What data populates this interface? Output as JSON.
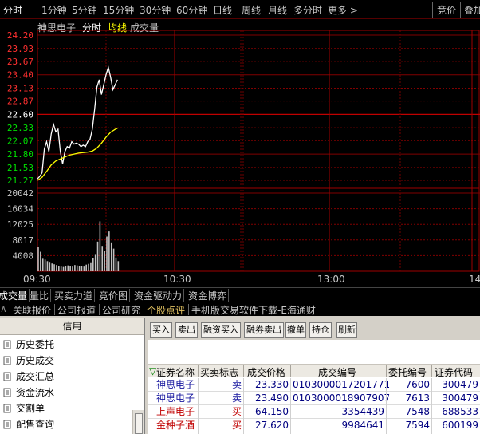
{
  "toolbar": {
    "periods": [
      "分时",
      "1分钟",
      "5分钟",
      "15分钟",
      "30分钟",
      "60分钟",
      "日线",
      "周线",
      "月线",
      "多分时",
      "更多 >"
    ],
    "right_items": [
      "竞价",
      "叠加"
    ]
  },
  "stock": {
    "name": "神思电子",
    "mode": "分时",
    "avg_label": "均线",
    "volume_label": "成交量"
  },
  "chart_data": {
    "type": "line",
    "price_axis": [
      "24.20",
      "23.93",
      "23.67",
      "23.40",
      "23.13",
      "22.87",
      "22.60",
      "22.33",
      "22.07",
      "21.80",
      "21.53",
      "21.27"
    ],
    "reference_price": 22.6,
    "price_range": [
      21.0,
      24.2
    ],
    "volume_axis": [
      "20042",
      "16034",
      "12025",
      "8017",
      "4008"
    ],
    "volume_range": [
      0,
      22000
    ],
    "time_axis": [
      "09:30",
      "10:30",
      "13:00",
      "14"
    ],
    "session_minutes": 240,
    "series": [
      {
        "name": "分时",
        "color": "#ffffff",
        "x": [
          0,
          1,
          2,
          3,
          4,
          5,
          6,
          7,
          8,
          9,
          10,
          11,
          12,
          13,
          14,
          15,
          16,
          17,
          18,
          19,
          20,
          21,
          22,
          23,
          24,
          25,
          26,
          27,
          28,
          29,
          30,
          31,
          32,
          33,
          34,
          35
        ],
        "values": [
          21.3,
          21.35,
          21.42,
          21.9,
          22.05,
          21.85,
          22.2,
          22.4,
          22.25,
          22.3,
          21.85,
          21.6,
          21.85,
          21.95,
          21.92,
          22.05,
          22.0,
          22.02,
          22.0,
          21.95,
          21.98,
          21.95,
          22.05,
          22.1,
          22.3,
          22.7,
          23.15,
          23.3,
          23.0,
          23.2,
          23.4,
          23.55,
          23.35,
          23.1,
          23.2,
          23.3
        ]
      },
      {
        "name": "均线",
        "color": "#ffff00",
        "x": [
          0,
          2,
          4,
          6,
          8,
          10,
          12,
          14,
          16,
          18,
          20,
          22,
          24,
          26,
          28,
          30,
          32,
          34,
          35
        ],
        "values": [
          21.27,
          21.33,
          21.45,
          21.58,
          21.66,
          21.7,
          21.74,
          21.78,
          21.8,
          21.82,
          21.83,
          21.84,
          21.86,
          21.92,
          22.02,
          22.14,
          22.24,
          22.3,
          22.32
        ]
      }
    ],
    "volumes": [
      6200,
      5000,
      3200,
      3000,
      2600,
      2200,
      2000,
      1800,
      1600,
      1400,
      1200,
      1100,
      1300,
      1500,
      1400,
      1200,
      1600,
      1500,
      1300,
      1400,
      1200,
      1700,
      1900,
      2100,
      3300,
      4200,
      7600,
      12800,
      6500,
      5200,
      8900,
      10200,
      7400,
      5800,
      3500,
      2600
    ],
    "volume_color": "#c0c0c0",
    "ylabel": "",
    "xlabel": ""
  },
  "indicator_tabs": [
    "成交量",
    "量比",
    "买卖力道",
    "竞价图",
    "资金驱动力",
    "资金博弈"
  ],
  "links": [
    "关联报价",
    "公司报道",
    "公司研究",
    "个股点评",
    "手机版交易软件下载-E海通财"
  ],
  "credit_panel": {
    "title": "信用",
    "items": [
      "历史委托",
      "历史成交",
      "成交汇总",
      "资金流水",
      "交割单",
      "配售查询"
    ]
  },
  "order_buttons": [
    "买入",
    "卖出",
    "融资买入",
    "融券卖出",
    "撤单",
    "持仓",
    "刷新"
  ],
  "order_table": {
    "headers": [
      "证券名称",
      "买卖标志",
      "成交价格",
      "成交编号",
      "委托编号",
      "证券代码"
    ],
    "rows": [
      {
        "name": "神思电子",
        "side": "卖",
        "price": "23.330",
        "deal_no": "0103000017201771",
        "order_no": "7600",
        "code": "300479",
        "color": "#1a1aa0"
      },
      {
        "name": "神思电子",
        "side": "卖",
        "price": "23.490",
        "deal_no": "0103000018907907",
        "order_no": "7613",
        "code": "300479",
        "color": "#1a1aa0"
      },
      {
        "name": "上声电子",
        "side": "买",
        "price": "64.150",
        "deal_no": "3354439",
        "order_no": "7548",
        "code": "688533",
        "color": "#c00000"
      },
      {
        "name": "金种子酒",
        "side": "买",
        "price": "27.620",
        "deal_no": "9984641",
        "order_no": "7594",
        "code": "600199",
        "color": "#c00000"
      }
    ]
  }
}
